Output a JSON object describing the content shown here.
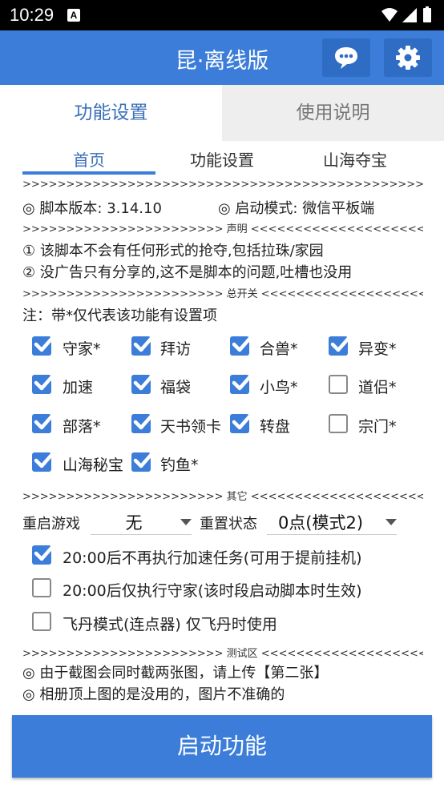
{
  "status_bar": {
    "time": "10:29",
    "notification_letter": "A",
    "icons": [
      "wifi-icon",
      "signal-icon",
      "battery-icon"
    ]
  },
  "app_bar": {
    "title": "昆·离线版",
    "icons": [
      "chat-icon",
      "gear-icon"
    ]
  },
  "main_tabs": [
    "功能设置",
    "使用说明"
  ],
  "sub_tabs": [
    "首页",
    "功能设置",
    "山海夺宝"
  ],
  "separator_top": ">>>>>>>>>>>>>>>>>>>>>>>>>>>>>>>>>>>>>>>>>>>>>>>>>>>>>>>>",
  "version_line": {
    "version": "◎ 脚本版本: 3.14.10",
    "mode": "◎ 启动模式: 微信平板端"
  },
  "sep_notice": ">>>>>>>>>>>>>>>>>>>>>>> 声明 <<<<<<<<<<<<<<<<<<<<<<<",
  "notices": [
    "① 该脚本不会有任何形式的抢夺,包括拉珠/家园",
    "② 没广告只有分享的,这不是脚本的问题,吐槽也没用"
  ],
  "sep_master": ">>>>>>>>>>>>>>>>>>>>>>> 总开关 <<<<<<<<<<<<<<<<<<<<<<",
  "note": "注：带*仅代表该功能有设置项",
  "features": [
    {
      "label": "守家*",
      "checked": true
    },
    {
      "label": "拜访",
      "checked": true
    },
    {
      "label": "合兽*",
      "checked": true
    },
    {
      "label": "异变*",
      "checked": true
    },
    {
      "label": "加速",
      "checked": true
    },
    {
      "label": "福袋",
      "checked": true
    },
    {
      "label": "小鸟*",
      "checked": true
    },
    {
      "label": "道侣*",
      "checked": false
    },
    {
      "label": "部落*",
      "checked": true
    },
    {
      "label": "天书领卡",
      "checked": true
    },
    {
      "label": "转盘",
      "checked": true
    },
    {
      "label": "宗门*",
      "checked": false
    },
    {
      "label": "山海秘宝",
      "checked": true
    },
    {
      "label": "钓鱼*",
      "checked": true
    }
  ],
  "sep_other": ">>>>>>>>>>>>>>>>>>>>>>> 其它 <<<<<<<<<<<<<<<<<<<<<<<",
  "restart": {
    "label": "重启游戏",
    "value": "无"
  },
  "reset": {
    "label": "重置状态",
    "value": "0点(模式2)"
  },
  "options": [
    {
      "label": "20:00后不再执行加速任务(可用于提前挂机)",
      "checked": true
    },
    {
      "label": "20:00后仅执行守家(该时段启动脚本时生效)",
      "checked": false
    },
    {
      "label": "飞丹模式(连点器) 仅飞丹时使用",
      "checked": false
    }
  ],
  "sep_test": ">>>>>>>>>>>>>>>>>>>>>>> 测试区 <<<<<<<<<<<<<<<<<<<<<<",
  "test_lines": [
    "◎ 由于截图会同时截两张图，请上传【第二张】",
    "◎ 相册顶上图的是没用的，图片不准确的"
  ],
  "start_button": "启动功能",
  "colors": {
    "primary": "#3b7dd8",
    "tab_active_text": "#3a6fb8"
  }
}
